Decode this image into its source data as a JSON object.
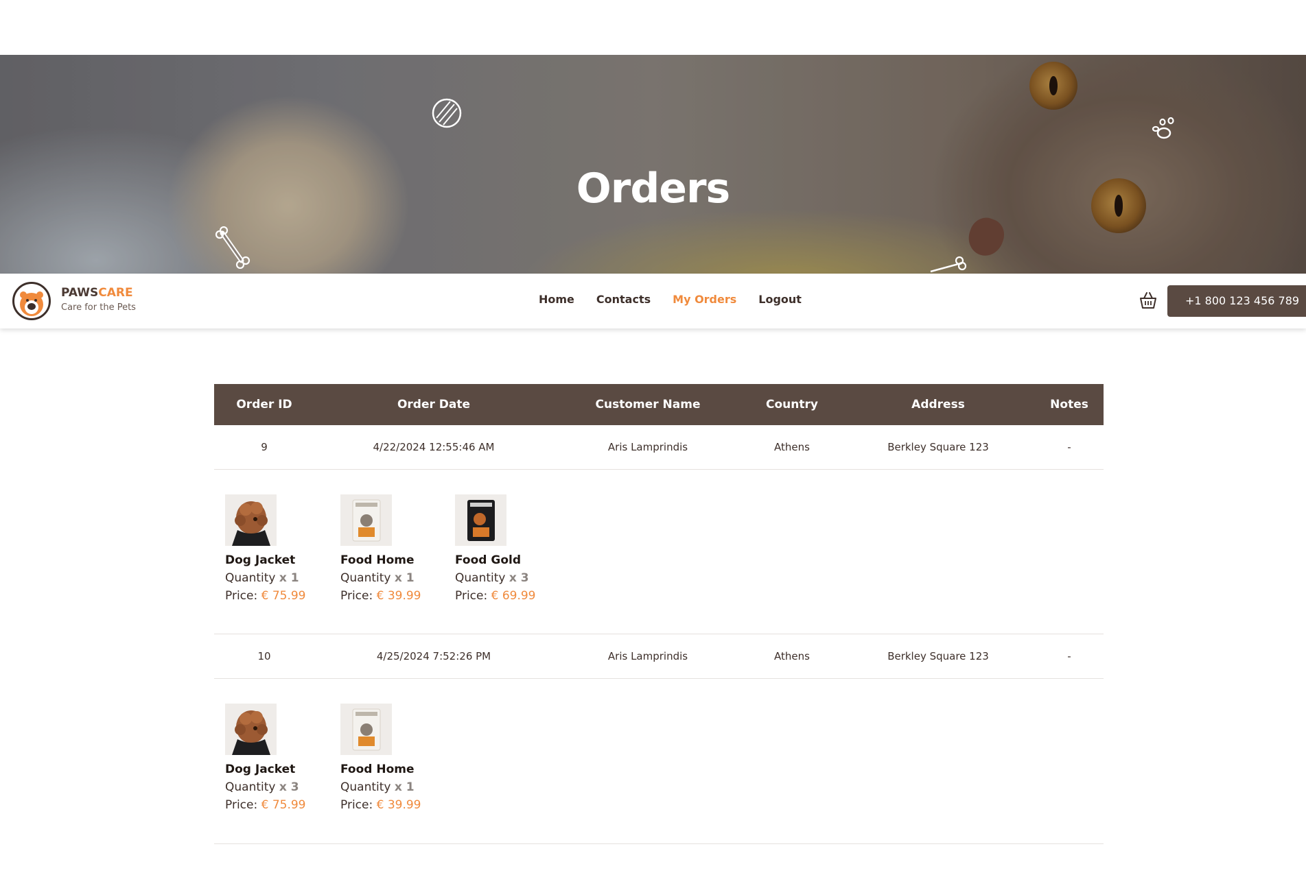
{
  "hero": {
    "title": "Orders"
  },
  "brand": {
    "name_part1": "PAWS",
    "name_part2": "CARE",
    "tagline": "Care for the Pets"
  },
  "nav": {
    "items": [
      {
        "label": "Home"
      },
      {
        "label": "Contacts"
      },
      {
        "label": "My Orders",
        "active": true
      },
      {
        "label": "Logout"
      }
    ]
  },
  "header_actions": {
    "basket_icon": "basket-icon",
    "phone": "+1 800 123 456 789"
  },
  "table": {
    "columns": [
      "Order ID",
      "Order Date",
      "Customer Name",
      "Country",
      "Address",
      "Notes"
    ],
    "orders": [
      {
        "id": "9",
        "date": "4/22/2024 12:55:46 AM",
        "customer": "Aris Lamprindis",
        "country": "Athens",
        "address": "Berkley Square 123",
        "notes": "-",
        "items": [
          {
            "name": "Dog Jacket",
            "qty_label": "Quantity",
            "qty": "x 1",
            "price_label": "Price:",
            "price": "€ 75.99"
          },
          {
            "name": "Food Home",
            "qty_label": "Quantity",
            "qty": "x 1",
            "price_label": "Price:",
            "price": "€ 39.99"
          },
          {
            "name": "Food Gold",
            "qty_label": "Quantity",
            "qty": "x 3",
            "price_label": "Price:",
            "price": "€ 69.99"
          }
        ]
      },
      {
        "id": "10",
        "date": "4/25/2024 7:52:26 PM",
        "customer": "Aris Lamprindis",
        "country": "Athens",
        "address": "Berkley Square 123",
        "notes": "-",
        "items": [
          {
            "name": "Dog Jacket",
            "qty_label": "Quantity",
            "qty": "x 3",
            "price_label": "Price:",
            "price": "€ 75.99"
          },
          {
            "name": "Food Home",
            "qty_label": "Quantity",
            "qty": "x 1",
            "price_label": "Price:",
            "price": "€ 39.99"
          }
        ]
      }
    ]
  },
  "colors": {
    "accent": "#f08a3c",
    "brown": "#5a4a42",
    "text": "#3d2f2a"
  }
}
